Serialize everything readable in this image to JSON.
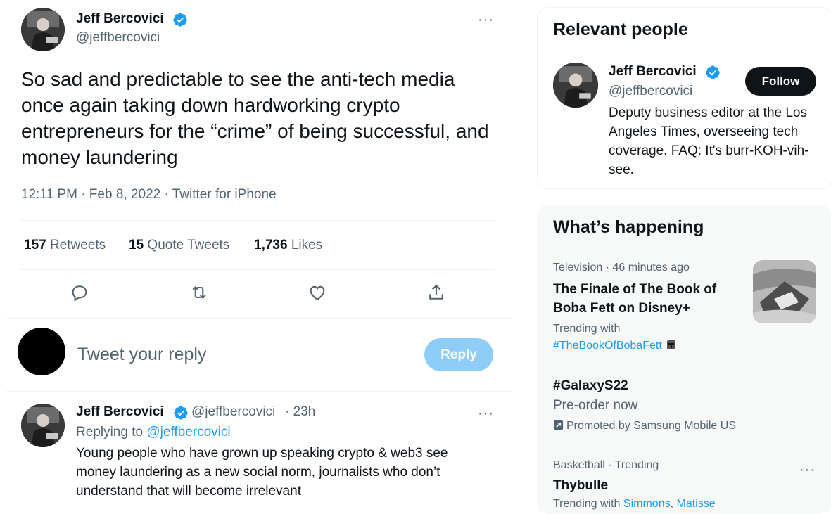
{
  "tweet": {
    "author_name": "Jeff Bercovici",
    "author_handle": "@jeffbercovici",
    "more": "···",
    "text": "So sad and predictable to see the anti-tech media once again taking down hardworking crypto entrepreneurs for the “crime” of being successful, and money laundering",
    "timestamp": "12:11 PM · Feb 8, 2022 · Twitter for iPhone",
    "stats": {
      "retweets_count": "157",
      "retweets_label": "Retweets",
      "quotes_count": "15",
      "quotes_label": "Quote Tweets",
      "likes_count": "1,736",
      "likes_label": "Likes"
    },
    "actions": [
      "reply-icon",
      "retweet-icon",
      "like-icon",
      "share-icon"
    ]
  },
  "reply_box": {
    "placeholder": "Tweet your reply",
    "button": "Reply"
  },
  "reply_tweet": {
    "author_name": "Jeff Bercovici",
    "author_handle": "@jeffbercovici",
    "time": "· 23h",
    "more": "···",
    "replying_label": "Replying to",
    "replying_handle": "@jeffbercovici",
    "text": "Young people who have grown up speaking crypto & web3 see money laundering as a new social norm, journalists who don’t understand that will become irrelevant"
  },
  "relevant_people": {
    "title": "Relevant people",
    "name": "Jeff Bercovici",
    "handle": "@jeffbercovici",
    "follow": "Follow",
    "bio": "Deputy business editor at the Los Angeles Times, overseeing tech coverage. FAQ: It's burr-KOH-vih-see."
  },
  "whats_happening": {
    "title": "What’s happening",
    "trend1": {
      "meta": "Television · 46 minutes ago",
      "title": "The Finale of The Book of Boba Fett on Disney+",
      "trending_with": "Trending with",
      "hashtag": "#TheBookOfBobaFett"
    },
    "trend2": {
      "title": "#GalaxyS22",
      "sub": "Pre-order now",
      "promoted": "Promoted by Samsung Mobile US"
    },
    "trend3": {
      "meta": "Basketball · Trending",
      "title": "Thybulle",
      "trending_with": "Trending with",
      "link1": "Simmons",
      "sep": ",",
      "link2": "Matisse",
      "more": "···"
    }
  },
  "colors": {
    "accent": "#1d9bf0",
    "reply_disabled": "#8ecdf8",
    "text_primary": "#0f1419",
    "text_secondary": "#536471"
  }
}
